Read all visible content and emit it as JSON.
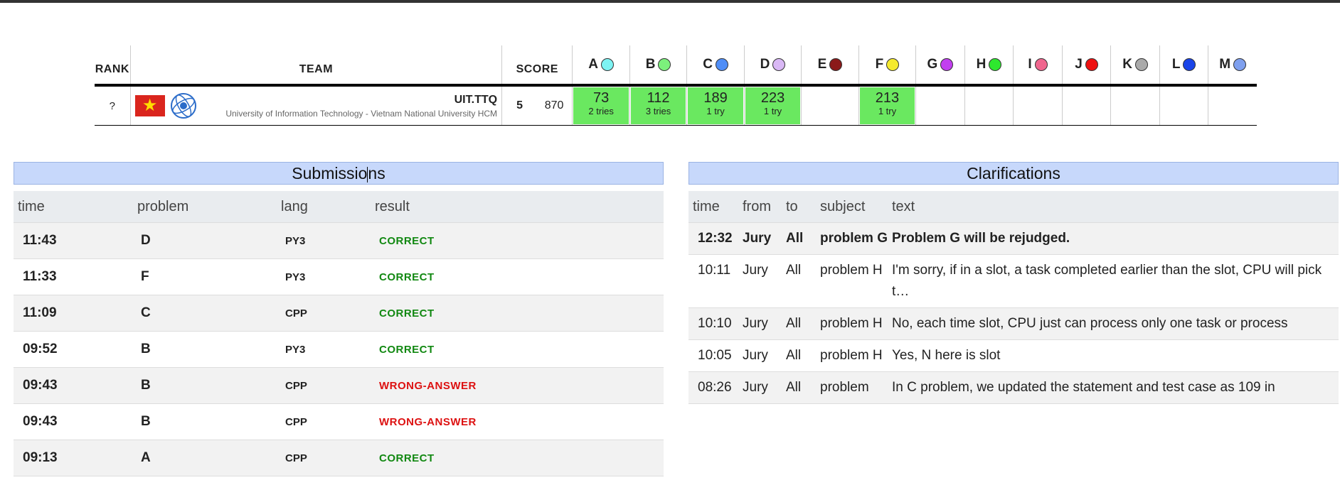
{
  "scoreboard": {
    "headers": {
      "rank": "RANK",
      "team": "TEAM",
      "score": "SCORE"
    },
    "problems": [
      {
        "label": "A",
        "color": "#7df3f3"
      },
      {
        "label": "B",
        "color": "#7cf07c"
      },
      {
        "label": "C",
        "color": "#4f8ef7"
      },
      {
        "label": "D",
        "color": "#d9b8f5"
      },
      {
        "label": "E",
        "color": "#8b1a1a"
      },
      {
        "label": "F",
        "color": "#f5ea2f"
      },
      {
        "label": "G",
        "color": "#c23ff0"
      },
      {
        "label": "H",
        "color": "#2ee82e"
      },
      {
        "label": "I",
        "color": "#f0668e"
      },
      {
        "label": "J",
        "color": "#ee1111"
      },
      {
        "label": "K",
        "color": "#aaaaaa"
      },
      {
        "label": "L",
        "color": "#1a44e8"
      },
      {
        "label": "M",
        "color": "#7fa0ee"
      }
    ],
    "team": {
      "rank": "?",
      "name": "UIT.TTQ",
      "affiliation": "University of Information Technology - Vietnam National University HCM",
      "solved": "5",
      "penalty": "870",
      "results": [
        {
          "time": "73",
          "tries": "2 tries"
        },
        {
          "time": "112",
          "tries": "3 tries"
        },
        {
          "time": "189",
          "tries": "1 try"
        },
        {
          "time": "223",
          "tries": "1 try"
        },
        null,
        {
          "time": "213",
          "tries": "1 try"
        },
        null,
        null,
        null,
        null,
        null,
        null,
        null
      ]
    }
  },
  "submissions": {
    "title_before_cursor": "Submissio",
    "title_after_cursor": "ns",
    "columns": {
      "time": "time",
      "problem": "problem",
      "lang": "lang",
      "result": "result"
    },
    "rows": [
      {
        "time": "11:43",
        "problem": "D",
        "lang": "PY3",
        "result": "CORRECT",
        "status": "correct"
      },
      {
        "time": "11:33",
        "problem": "F",
        "lang": "PY3",
        "result": "CORRECT",
        "status": "correct"
      },
      {
        "time": "11:09",
        "problem": "C",
        "lang": "CPP",
        "result": "CORRECT",
        "status": "correct"
      },
      {
        "time": "09:52",
        "problem": "B",
        "lang": "PY3",
        "result": "CORRECT",
        "status": "correct"
      },
      {
        "time": "09:43",
        "problem": "B",
        "lang": "CPP",
        "result": "WRONG-ANSWER",
        "status": "wrong"
      },
      {
        "time": "09:43",
        "problem": "B",
        "lang": "CPP",
        "result": "WRONG-ANSWER",
        "status": "wrong"
      },
      {
        "time": "09:13",
        "problem": "A",
        "lang": "CPP",
        "result": "CORRECT",
        "status": "correct"
      }
    ]
  },
  "clarifications": {
    "title": "Clarifications",
    "columns": {
      "time": "time",
      "from": "from",
      "to": "to",
      "subject": "subject",
      "text": "text"
    },
    "rows": [
      {
        "time": "12:32",
        "from": "Jury",
        "to": "All",
        "subject": "problem G",
        "text": "Problem G will be rejudged.",
        "unread": true
      },
      {
        "time": "10:11",
        "from": "Jury",
        "to": "All",
        "subject": "problem H",
        "text": "I'm sorry, if in a slot, a task completed earlier than the slot, CPU will pick t…",
        "unread": false
      },
      {
        "time": "10:10",
        "from": "Jury",
        "to": "All",
        "subject": "problem H",
        "text": "No, each time slot, CPU just can process only one task or process",
        "unread": false
      },
      {
        "time": "10:05",
        "from": "Jury",
        "to": "All",
        "subject": "problem H",
        "text": "Yes, N here is slot",
        "unread": false
      },
      {
        "time": "08:26",
        "from": "Jury",
        "to": "All",
        "subject": "problem",
        "text": "In C problem, we updated the statement and test case as 109 in",
        "unread": false
      }
    ]
  }
}
